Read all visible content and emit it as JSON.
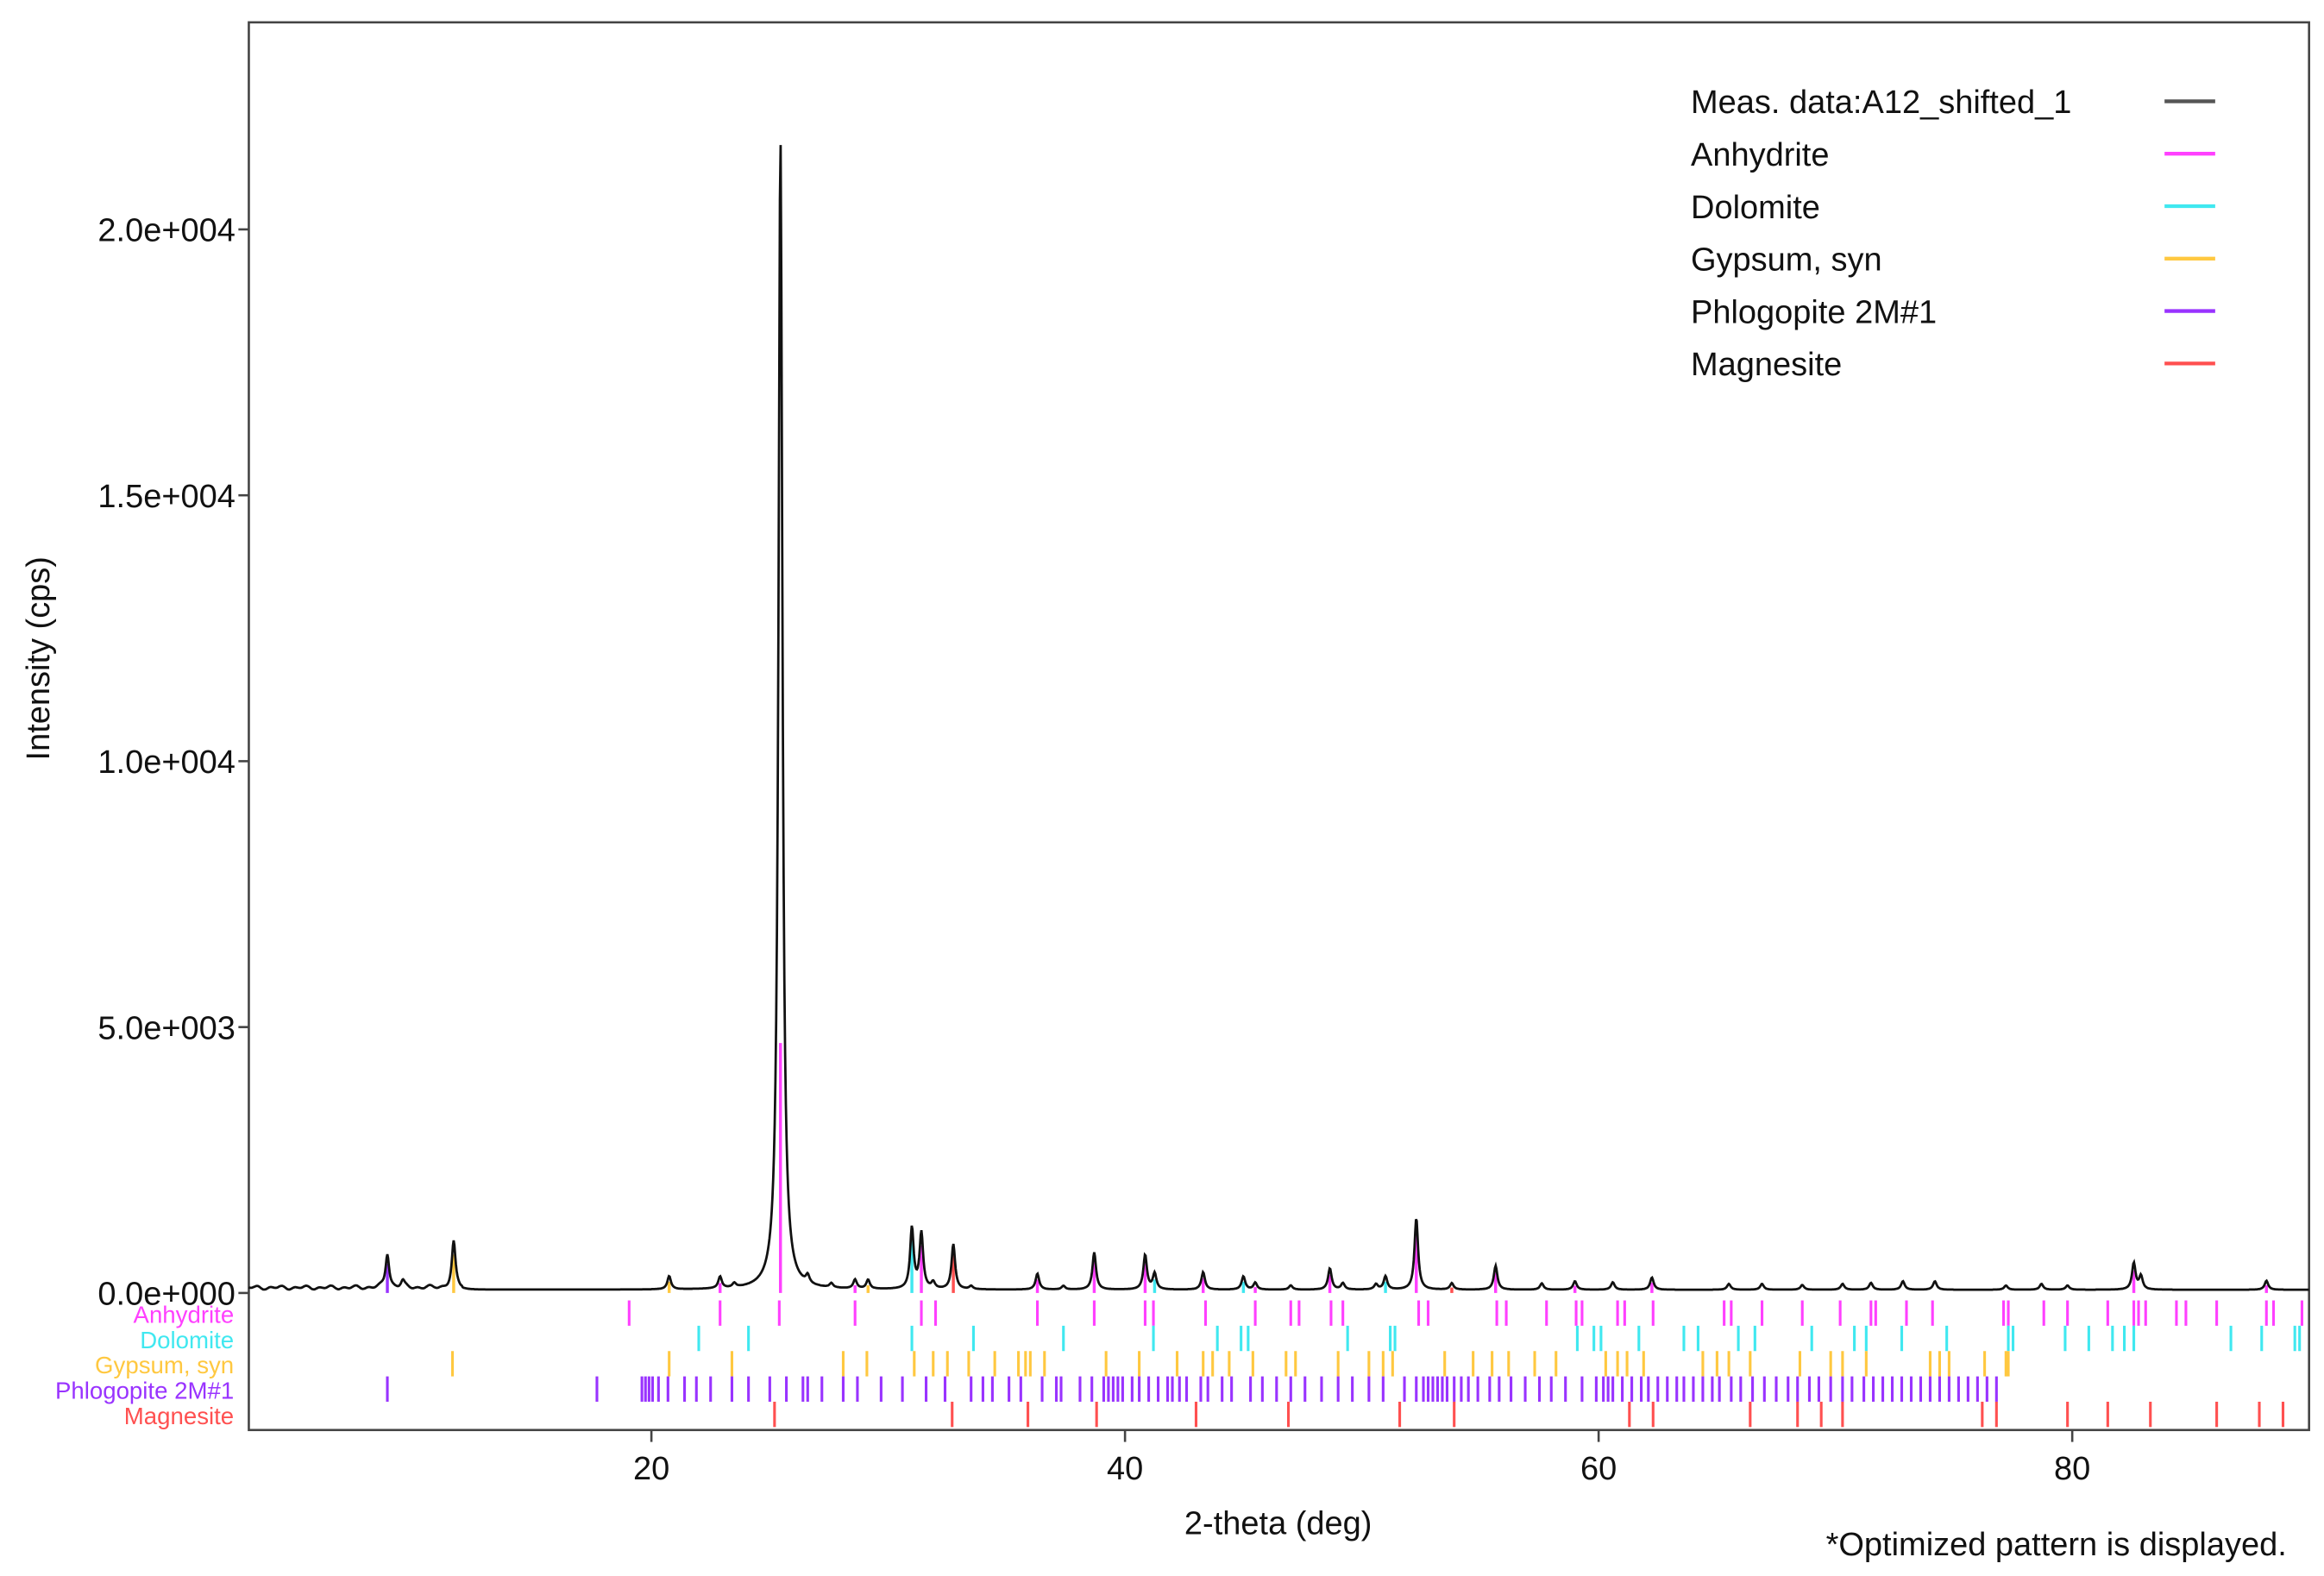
{
  "chart_data": {
    "type": "line",
    "title": "",
    "xlabel": "2-theta (deg)",
    "ylabel": "Intensity (cps)",
    "xlim": [
      3,
      90
    ],
    "ylim": [
      -300,
      23900
    ],
    "xticks": [
      20,
      40,
      60,
      80
    ],
    "xtick_labels": [
      "20",
      "40",
      "60",
      "80"
    ],
    "yticks": [
      0,
      5000,
      10000,
      15000,
      20000
    ],
    "ytick_labels": [
      "0.0e+000",
      "5.0e+003",
      "1.0e+004",
      "1.5e+004",
      "2.0e+004"
    ],
    "grid": false,
    "legend_position": "top-right",
    "note": "*Optimized pattern is displayed.",
    "series": [
      {
        "name": "Meas. data:A12_shifted_1",
        "color": "#555555",
        "baseline": 60,
        "peaks": [
          {
            "x": 8.85,
            "y": 650,
            "phase": "Phlogopite 2M#1"
          },
          {
            "x": 9.5,
            "y": 120,
            "phase": ""
          },
          {
            "x": 11.65,
            "y": 850,
            "phase": "Gypsum, syn"
          },
          {
            "x": 20.75,
            "y": 250,
            "phase": "Gypsum, syn"
          },
          {
            "x": 22.9,
            "y": 220,
            "phase": "Anhydrite"
          },
          {
            "x": 23.5,
            "y": 80,
            "phase": ""
          },
          {
            "x": 25.45,
            "y": 21650,
            "phase": "Anhydrite"
          },
          {
            "x": 26.6,
            "y": 150,
            "phase": ""
          },
          {
            "x": 27.6,
            "y": 80,
            "phase": ""
          },
          {
            "x": 28.6,
            "y": 170,
            "phase": "Anhydrite"
          },
          {
            "x": 29.15,
            "y": 170,
            "phase": "Gypsum, syn"
          },
          {
            "x": 31.0,
            "y": 1150,
            "phase": "Dolomite"
          },
          {
            "x": 31.4,
            "y": 1050,
            "phase": "Anhydrite"
          },
          {
            "x": 31.9,
            "y": 120,
            "phase": ""
          },
          {
            "x": 32.75,
            "y": 850,
            "phase": "Magnesite"
          },
          {
            "x": 33.5,
            "y": 60,
            "phase": ""
          },
          {
            "x": 36.3,
            "y": 300,
            "phase": "Anhydrite"
          },
          {
            "x": 37.4,
            "y": 70,
            "phase": ""
          },
          {
            "x": 38.7,
            "y": 700,
            "phase": "Anhydrite"
          },
          {
            "x": 40.85,
            "y": 650,
            "phase": "Anhydrite"
          },
          {
            "x": 41.25,
            "y": 300,
            "phase": "Dolomite"
          },
          {
            "x": 43.3,
            "y": 330,
            "phase": "Anhydrite"
          },
          {
            "x": 45.0,
            "y": 250,
            "phase": "Dolomite"
          },
          {
            "x": 45.5,
            "y": 130,
            "phase": "Anhydrite"
          },
          {
            "x": 47.0,
            "y": 80,
            "phase": ""
          },
          {
            "x": 48.65,
            "y": 400,
            "phase": "Anhydrite"
          },
          {
            "x": 49.2,
            "y": 120,
            "phase": ""
          },
          {
            "x": 50.6,
            "y": 100,
            "phase": ""
          },
          {
            "x": 51.0,
            "y": 250,
            "phase": "Dolomite"
          },
          {
            "x": 52.3,
            "y": 1350,
            "phase": "Anhydrite"
          },
          {
            "x": 53.8,
            "y": 120,
            "phase": "Magnesite"
          },
          {
            "x": 55.65,
            "y": 450,
            "phase": "Anhydrite"
          },
          {
            "x": 57.6,
            "y": 120,
            "phase": ""
          },
          {
            "x": 59.0,
            "y": 160,
            "phase": "Anhydrite"
          },
          {
            "x": 60.6,
            "y": 140,
            "phase": ""
          },
          {
            "x": 62.25,
            "y": 230,
            "phase": "Anhydrite"
          },
          {
            "x": 65.5,
            "y": 110,
            "phase": ""
          },
          {
            "x": 66.9,
            "y": 110,
            "phase": ""
          },
          {
            "x": 68.6,
            "y": 90,
            "phase": ""
          },
          {
            "x": 70.3,
            "y": 110,
            "phase": ""
          },
          {
            "x": 71.5,
            "y": 130,
            "phase": ""
          },
          {
            "x": 72.85,
            "y": 160,
            "phase": ""
          },
          {
            "x": 74.2,
            "y": 160,
            "phase": ""
          },
          {
            "x": 77.2,
            "y": 80,
            "phase": ""
          },
          {
            "x": 78.7,
            "y": 110,
            "phase": ""
          },
          {
            "x": 79.8,
            "y": 80,
            "phase": ""
          },
          {
            "x": 82.6,
            "y": 500,
            "phase": "Anhydrite"
          },
          {
            "x": 82.9,
            "y": 250,
            "phase": ""
          },
          {
            "x": 88.2,
            "y": 170,
            "phase": "Anhydrite"
          }
        ]
      },
      {
        "name": "Anhydrite",
        "color": "#ff40ff",
        "ticks": [
          19.06,
          22.9,
          25.4,
          28.6,
          31.4,
          32.0,
          36.3,
          38.7,
          40.85,
          41.2,
          43.4,
          45.5,
          47.0,
          47.35,
          48.7,
          49.2,
          52.4,
          52.8,
          55.7,
          56.1,
          57.8,
          59.05,
          59.3,
          60.8,
          61.1,
          62.3,
          65.3,
          65.6,
          66.9,
          68.6,
          70.2,
          71.5,
          71.7,
          73.0,
          74.1,
          77.1,
          77.3,
          78.8,
          79.8,
          81.5,
          82.6,
          82.8,
          83.1,
          84.4,
          84.8,
          86.1,
          88.2,
          88.5,
          89.7
        ]
      },
      {
        "name": "Dolomite",
        "color": "#40e8f0",
        "ticks": [
          22.0,
          24.1,
          31.0,
          33.6,
          37.4,
          41.2,
          43.9,
          44.9,
          45.2,
          49.4,
          51.2,
          51.4,
          59.1,
          59.8,
          60.1,
          61.7,
          63.6,
          64.2,
          65.9,
          66.6,
          69.0,
          70.8,
          71.3,
          72.8,
          74.7,
          77.3,
          77.5,
          79.7,
          80.7,
          81.7,
          82.2,
          82.6,
          86.7,
          88.0,
          89.4,
          89.6
        ]
      },
      {
        "name": "Gypsum, syn",
        "color": "#ffc840",
        "ticks": [
          11.6,
          20.75,
          23.4,
          28.1,
          29.1,
          31.1,
          31.9,
          32.5,
          33.4,
          34.5,
          35.5,
          35.8,
          36.0,
          36.6,
          39.2,
          40.6,
          42.2,
          43.3,
          43.7,
          44.4,
          45.4,
          46.8,
          47.2,
          49.0,
          50.3,
          50.9,
          51.3,
          53.5,
          54.7,
          55.5,
          56.2,
          57.3,
          58.2,
          60.3,
          60.8,
          61.2,
          61.9,
          64.4,
          65.0,
          65.5,
          66.4,
          68.5,
          69.8,
          70.3,
          71.3,
          74.0,
          74.4,
          74.8,
          76.3,
          77.2,
          77.3
        ]
      },
      {
        "name": "Phlogopite 2M#1",
        "color": "#9933ff",
        "ticks": [
          8.85,
          17.7,
          19.6,
          19.75,
          19.9,
          20.05,
          20.3,
          20.7,
          21.4,
          21.9,
          22.5,
          23.4,
          24.1,
          25.0,
          25.7,
          26.4,
          26.6,
          27.2,
          28.1,
          28.7,
          29.7,
          30.6,
          31.6,
          32.4,
          33.5,
          34.0,
          34.4,
          35.1,
          35.6,
          36.5,
          37.1,
          37.3,
          38.1,
          38.6,
          39.1,
          39.3,
          39.5,
          39.7,
          39.9,
          40.3,
          40.6,
          41.0,
          41.4,
          41.8,
          42.0,
          42.3,
          42.6,
          43.2,
          43.5,
          44.1,
          44.5,
          45.3,
          45.8,
          46.4,
          47.0,
          47.6,
          48.3,
          49.0,
          49.6,
          50.3,
          50.9,
          51.8,
          52.3,
          52.6,
          52.8,
          53.0,
          53.2,
          53.4,
          53.6,
          53.9,
          54.2,
          54.5,
          54.9,
          55.4,
          55.8,
          56.3,
          56.9,
          57.5,
          58.0,
          58.6,
          59.3,
          59.9,
          60.2,
          60.4,
          60.6,
          61.0,
          61.4,
          61.8,
          62.1,
          62.5,
          62.9,
          63.3,
          63.6,
          64.0,
          64.4,
          64.8,
          65.1,
          65.6,
          66.0,
          66.5,
          67.0,
          67.5,
          68.0,
          68.4,
          68.9,
          69.3,
          69.8,
          70.3,
          70.7,
          71.2,
          71.6,
          72.0,
          72.4,
          72.8,
          73.2,
          73.6,
          74.0,
          74.4,
          74.8,
          75.2,
          75.6,
          76.0,
          76.4,
          76.8
        ]
      },
      {
        "name": "Magnesite",
        "color": "#ff5050",
        "ticks": [
          25.2,
          32.7,
          35.9,
          38.8,
          43.0,
          46.9,
          51.6,
          53.9,
          61.3,
          62.3,
          66.4,
          68.4,
          69.4,
          70.3,
          76.2,
          76.8,
          79.8,
          81.5,
          83.3,
          86.1,
          87.9,
          88.9
        ]
      }
    ]
  }
}
